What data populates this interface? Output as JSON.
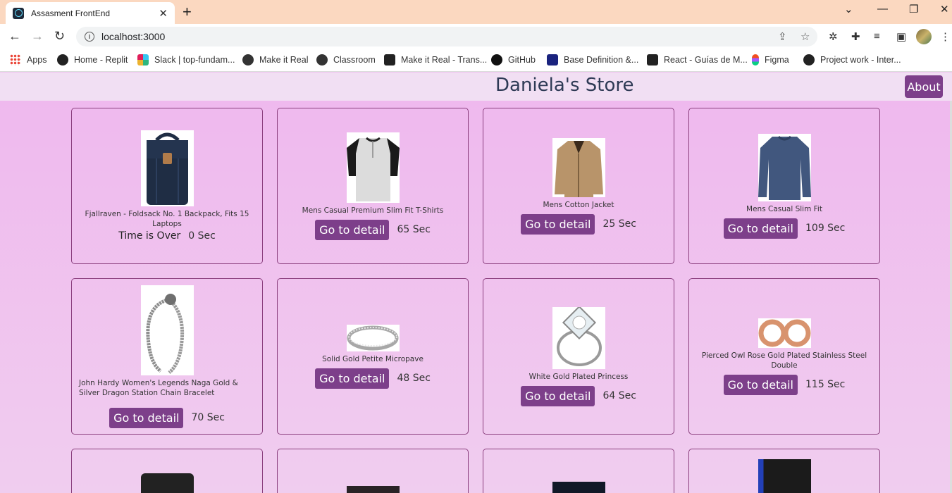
{
  "browser": {
    "tab_title": "Assasment FrontEnd",
    "url": "localhost:3000",
    "bookmarks": [
      {
        "label": "Apps",
        "color": "#4285f4"
      },
      {
        "label": "Home - Replit",
        "color": "#222222"
      },
      {
        "label": "Slack | top-fundam...",
        "color": "#e01e5a"
      },
      {
        "label": "Make it Real",
        "color": "#333333"
      },
      {
        "label": "Classroom",
        "color": "#333333"
      },
      {
        "label": "Make it Real - Trans...",
        "color": "#222222"
      },
      {
        "label": "GitHub",
        "color": "#111111"
      },
      {
        "label": "Base Definition &...",
        "color": "#1a237e"
      },
      {
        "label": "React - Guías de M...",
        "color": "#222222"
      },
      {
        "label": "Figma",
        "color": "#a259ff"
      },
      {
        "label": "Project work - Inter...",
        "color": "#222222"
      }
    ]
  },
  "app": {
    "title": "Daniela's Store",
    "about_label": "About",
    "detail_label": "Go to detail",
    "accent_color": "#7d3f8a",
    "products": [
      {
        "name": "Fjallraven - Foldsack No. 1 Backpack, Fits 15 Laptops",
        "status": "Time is Over",
        "seconds": "0 Sec",
        "icon": "backpack-image"
      },
      {
        "name": "Mens Casual Premium Slim Fit T-Shirts",
        "seconds": "65 Sec",
        "icon": "tshirt-image"
      },
      {
        "name": "Mens Cotton Jacket",
        "seconds": "25 Sec",
        "icon": "jacket-image"
      },
      {
        "name": "Mens Casual Slim Fit",
        "seconds": "109 Sec",
        "icon": "longsleeve-image"
      },
      {
        "name": "John Hardy Women's Legends Naga Gold & Silver Dragon Station Chain Bracelet",
        "seconds": "70 Sec",
        "icon": "bracelet-image"
      },
      {
        "name": "Solid Gold Petite Micropave",
        "seconds": "48 Sec",
        "icon": "ring-image"
      },
      {
        "name": "White Gold Plated Princess",
        "seconds": "64 Sec",
        "icon": "diamond-ring-image"
      },
      {
        "name": "Pierced Owl Rose Gold Plated Stainless Steel Double",
        "seconds": "115 Sec",
        "icon": "earrings-image"
      }
    ]
  }
}
